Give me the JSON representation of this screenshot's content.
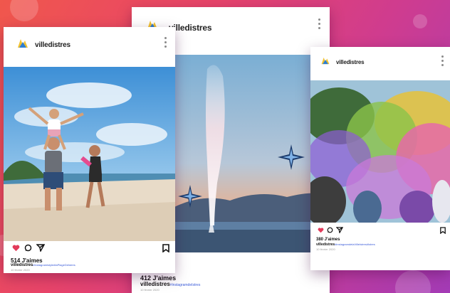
{
  "colors": {
    "heart": "#e23b5a",
    "hashtag": "#3a5bd9",
    "background_from": "#f0574c",
    "background_to": "#a33bb6"
  },
  "posts": [
    {
      "username": "villedistres",
      "likes": "514 J'aimes",
      "caption_user": "villedistres",
      "hashtags": "#instagramistyle#laPlageDeIstres",
      "date": "10 février 2020"
    },
    {
      "username": "villedistres",
      "likes": "412 J'aimes",
      "caption_user": "villedistres",
      "hashtags": "#instagramdeIstres",
      "date": "10 février 2020"
    },
    {
      "username": "villedistres",
      "likes": "380 J'aimes",
      "caption_user": "villedistres",
      "hashtags": "#instagramdelaVilleIstres#Istres",
      "date": "10 février 2020"
    }
  ],
  "icons": [
    "heart-icon",
    "comment-icon",
    "share-icon",
    "bookmark-icon",
    "more-options-icon"
  ]
}
